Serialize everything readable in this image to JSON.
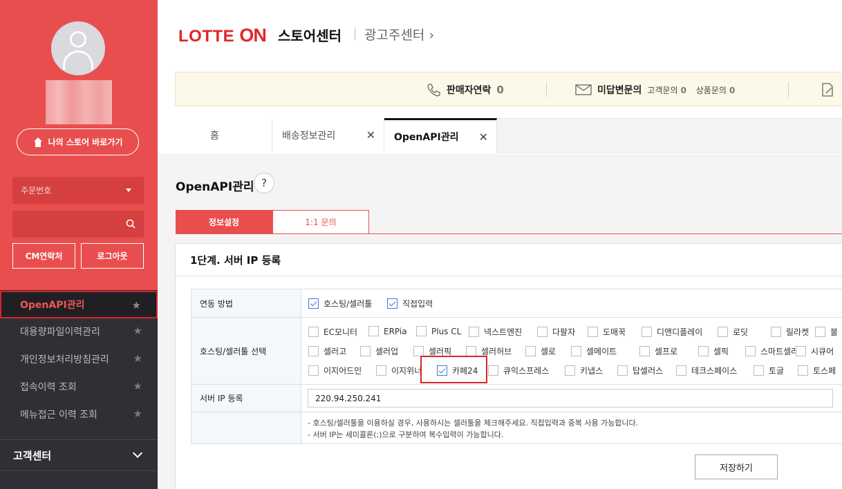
{
  "sidebar": {
    "store_button": "나의 스토어 바로가기",
    "order_select": "주문번호",
    "cm_button": "CM연락처",
    "logout_button": "로그아웃",
    "menu": [
      {
        "label": "OpenAPI관리"
      },
      {
        "label": "대용량파일이력관리"
      },
      {
        "label": "개인정보처리방침관리"
      },
      {
        "label": "접속이력 조회"
      },
      {
        "label": "메뉴접근 이력 조회"
      }
    ],
    "customer_center": "고객센터"
  },
  "header": {
    "logo_lotte": "LOTTE",
    "logo_on": "ON",
    "store_center": "스토어센터",
    "ad_center": "광고주센터 ›"
  },
  "notice": {
    "seller_contact_label": "판매자연락",
    "seller_contact_count": "0",
    "unanswered_label": "미답변문의",
    "customer_inquiry_label": "고객문의",
    "customer_inquiry_count": "0",
    "product_inquiry_label": "상품문의",
    "product_inquiry_count": "0"
  },
  "tabs": [
    {
      "label": "홈"
    },
    {
      "label": "배송정보관리",
      "close": "✕"
    },
    {
      "label": "OpenAPI관리",
      "close": "✕"
    }
  ],
  "page": {
    "title": "OpenAPI관리",
    "help": "?",
    "subtabs": [
      "정보설정",
      "1:1 문의"
    ],
    "step_title": "1단계. 서버 IP 등록"
  },
  "form": {
    "link_method_label": "연동 방법",
    "link_methods": [
      {
        "label": "호스팅/셀러툴",
        "checked": true
      },
      {
        "label": "직접입력",
        "checked": true
      }
    ],
    "tool_select_label": "호스팅/셀러툴 선택",
    "tools_row1": [
      "EC모니터",
      "ERPia",
      "Plus CL",
      "넥스트엔진",
      "다팔자",
      "도매꾹",
      "디앤디플레이",
      "로딧",
      "릴라켓",
      "불"
    ],
    "tools_row2": [
      "셀러고",
      "셀러업",
      "셀러픽",
      "셀러허브",
      "셀로",
      "셀메이트",
      "셀프로",
      "셀픽",
      "스마트셀러",
      "시큐어"
    ],
    "tools_row3": [
      "이지어드민",
      "이지위너",
      "카페24",
      "큐익스프레스",
      "키냅스",
      "탑셀러스",
      "테크스페이스",
      "토글",
      "토스페"
    ],
    "checked_tool": "카페24",
    "server_ip_label": "서버 IP 등록",
    "server_ip_value": "220.94.250.241",
    "notes": [
      "- 호스팅/셀러툴을 이용하실 경우, 사용하시는 셀러툴을 체크해주세요. 직접입력과 중복 사용 가능합니다.",
      "- 서버 IP는 세미콜론(;)으로 구분하여 복수입력이 가능합니다."
    ],
    "save_button": "저장하기"
  },
  "colors": {
    "brand_red": "#e94e4e",
    "sidebar_dark": "#2f2f36",
    "check_blue": "#3a7bd5"
  }
}
